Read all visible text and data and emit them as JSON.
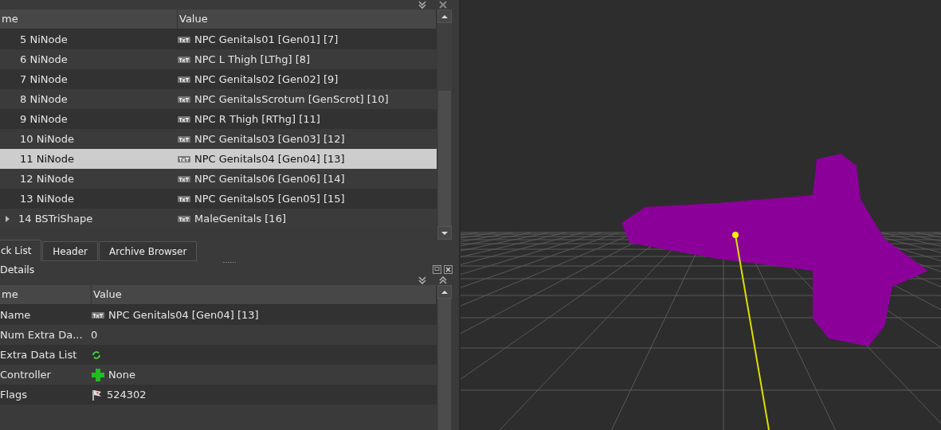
{
  "block_tree": {
    "columns": [
      "me",
      "Value"
    ],
    "rows": [
      {
        "name": "5 NiNode",
        "value": "NPC Genitals01 [Gen01] [7]",
        "selected": false,
        "collapsed_children": false
      },
      {
        "name": "6 NiNode",
        "value": "NPC L Thigh [LThg] [8]",
        "selected": false,
        "collapsed_children": false
      },
      {
        "name": "7 NiNode",
        "value": "NPC Genitals02 [Gen02] [9]",
        "selected": false,
        "collapsed_children": false
      },
      {
        "name": "8 NiNode",
        "value": "NPC GenitalsScrotum [GenScrot] [10]",
        "selected": false,
        "collapsed_children": false
      },
      {
        "name": "9 NiNode",
        "value": "NPC R Thigh [RThg] [11]",
        "selected": false,
        "collapsed_children": false
      },
      {
        "name": "10 NiNode",
        "value": "NPC Genitals03 [Gen03] [12]",
        "selected": false,
        "collapsed_children": false
      },
      {
        "name": "11 NiNode",
        "value": "NPC Genitals04 [Gen04] [13]",
        "selected": true,
        "collapsed_children": false
      },
      {
        "name": "12 NiNode",
        "value": "NPC Genitals06 [Gen06] [14]",
        "selected": false,
        "collapsed_children": false
      },
      {
        "name": "13 NiNode",
        "value": "NPC Genitals05 [Gen05] [15]",
        "selected": false,
        "collapsed_children": false
      },
      {
        "name": "14 BSTriShape",
        "value": "MaleGenitals [16]",
        "selected": false,
        "collapsed_children": true
      }
    ]
  },
  "tabs": [
    {
      "label": "ck List",
      "selected": true
    },
    {
      "label": "Header",
      "selected": false
    },
    {
      "label": "Archive Browser",
      "selected": false
    }
  ],
  "details": {
    "title": "Details",
    "columns": [
      "me",
      "Value"
    ],
    "rows": [
      {
        "name": "Name",
        "kind": "txt",
        "value": "NPC Genitals04 [Gen04] [13]"
      },
      {
        "name": "Num Extra Da...",
        "kind": "plain",
        "value": "0"
      },
      {
        "name": "Extra Data List",
        "kind": "refresh"
      },
      {
        "name": "Controller",
        "kind": "add",
        "value": "None"
      },
      {
        "name": "Flags",
        "kind": "flags",
        "value": "524302"
      }
    ]
  }
}
